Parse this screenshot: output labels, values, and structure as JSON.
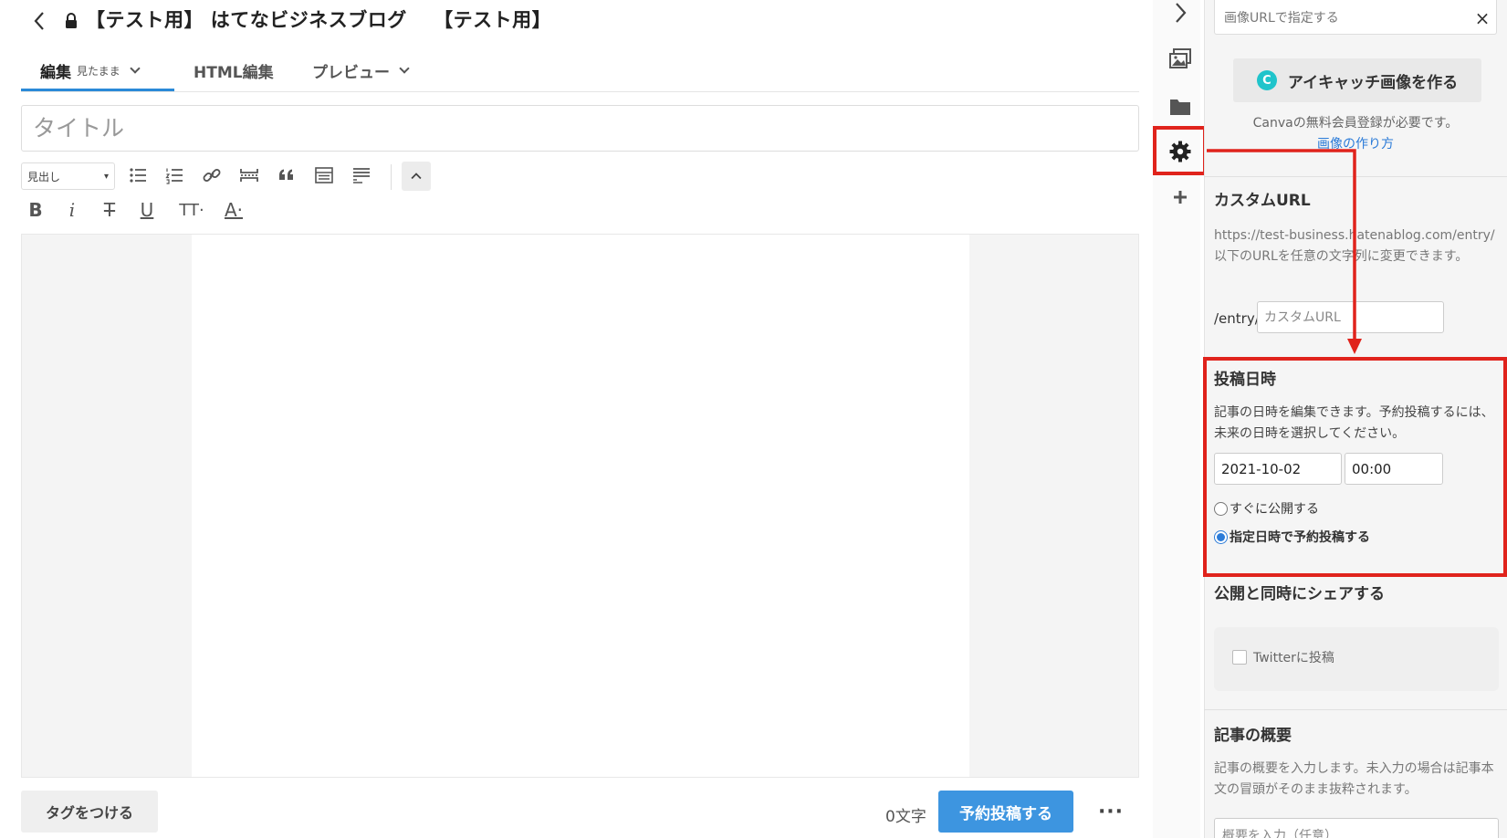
{
  "header": {
    "title": "【テスト用】 はてなビジネスブログ　 【テスト用】"
  },
  "tabs": [
    {
      "label": "編集",
      "sub": "見たまま"
    },
    {
      "label": "HTML編集"
    },
    {
      "label": "プレビュー"
    }
  ],
  "editor": {
    "title_placeholder": "タイトル",
    "heading_select": "見出し"
  },
  "toolbar": {
    "format": {
      "bold": "B",
      "italic": "i",
      "strike": "T",
      "underline": "U",
      "fontsize": "TT·",
      "color": "A·"
    }
  },
  "footer": {
    "tag_button": "タグをつける",
    "char_count": "0文字",
    "submit_button": "予約投稿する",
    "more_button": "···"
  },
  "panel": {
    "image_url_label": "画像URLで指定する",
    "close_icon": "×",
    "canva": {
      "logo": "C",
      "button": "アイキャッチ画像を作る",
      "note": "Canvaの無料会員登録が必要です。",
      "howto_link": "画像の作り方"
    },
    "custom_url": {
      "title": "カスタムURL",
      "description": "https://test-business.hatenablog.com/entry/以下のURLを任意の文字列に変更できます。",
      "prefix": "/entry/",
      "placeholder": "カスタムURL"
    },
    "post_date": {
      "title": "投稿日時",
      "description": "記事の日時を編集できます。予約投稿するには、未来の日時を選択してください。",
      "date": "2021-10-02",
      "time": "00:00",
      "option_now": "すぐに公開する",
      "option_scheduled": "指定日時で予約投稿する"
    },
    "share": {
      "title": "公開と同時にシェアする",
      "twitter": "Twitterに投稿"
    },
    "summary": {
      "title": "記事の概要",
      "description": "記事の概要を入力します。未入力の場合は記事本文の冒頭がそのまま抜粋されます。",
      "placeholder": "概要を入力（任意）"
    }
  },
  "colors": {
    "accent": "#3d95e0",
    "highlight": "#e0231c",
    "link": "#2b7bd8",
    "canva": "#20c4cb"
  },
  "icons": [
    "back-icon",
    "lock-icon",
    "bullet-list-icon",
    "numbered-list-icon",
    "link-icon",
    "more-break-icon",
    "quote-icon",
    "table-icon",
    "footnote-icon",
    "collapse-icon",
    "sidebar-toggle-icon",
    "image-icon",
    "folder-icon",
    "gear-icon",
    "plus-icon"
  ]
}
